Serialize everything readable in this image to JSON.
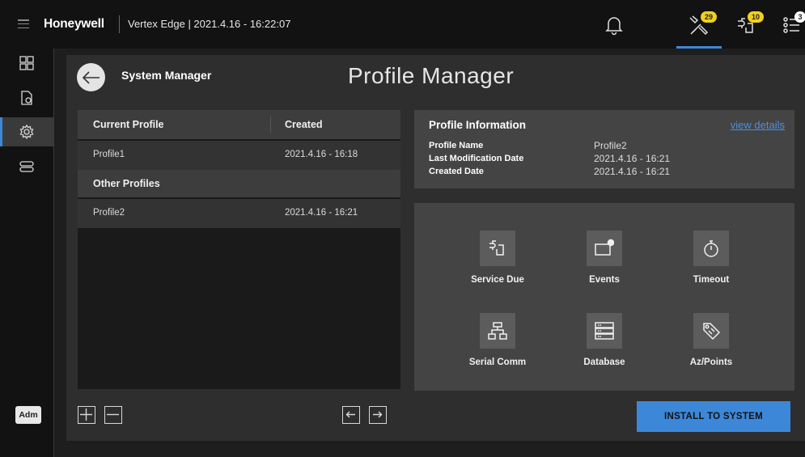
{
  "header": {
    "brand": "Honeywell",
    "app_title": "Vertex Edge | 2021.4.16 - 16:22:07",
    "icons": [
      {
        "name": "bell-icon",
        "badge": ""
      },
      {
        "name": "tools-icon",
        "badge": "29"
      },
      {
        "name": "service-icon",
        "badge": "10"
      },
      {
        "name": "list-icon",
        "badge": "3"
      }
    ],
    "accent_color": "#3d87d8",
    "badge_color": "#f0d020"
  },
  "sidebar": {
    "items": [
      {
        "name": "dashboard-icon",
        "active": false
      },
      {
        "name": "document-icon",
        "active": false
      },
      {
        "name": "settings-icon",
        "active": true
      },
      {
        "name": "devices-icon",
        "active": false
      }
    ],
    "user_label": "Adm"
  },
  "page": {
    "breadcrumb": "System Manager",
    "title": "Profile Manager"
  },
  "profiles": {
    "columns": [
      "Current Profile",
      "Created"
    ],
    "current": [
      {
        "name": "Profile1",
        "created": "2021.4.16 - 16:18"
      }
    ],
    "other_section_label": "Other Profiles",
    "other": [
      {
        "name": "Profile2",
        "created": "2021.4.16 - 16:21"
      }
    ]
  },
  "info": {
    "title": "Profile Information",
    "link": "view details",
    "fields": [
      {
        "label": "Profile Name",
        "value": "Profile2"
      },
      {
        "label": "Last Modification Date",
        "value": "2021.4.16 - 16:21"
      },
      {
        "label": "Created Date",
        "value": "2021.4.16 - 16:21"
      }
    ]
  },
  "features": [
    {
      "label": "Service Due",
      "icon": "service-due-icon"
    },
    {
      "label": "Events",
      "icon": "events-icon"
    },
    {
      "label": "Timeout",
      "icon": "timeout-icon"
    },
    {
      "label": "Serial Comm",
      "icon": "serial-comm-icon"
    },
    {
      "label": "Database",
      "icon": "database-icon"
    },
    {
      "label": "Az/Points",
      "icon": "az-points-icon"
    }
  ],
  "actions": {
    "install": "INSTALL TO SYSTEM"
  }
}
